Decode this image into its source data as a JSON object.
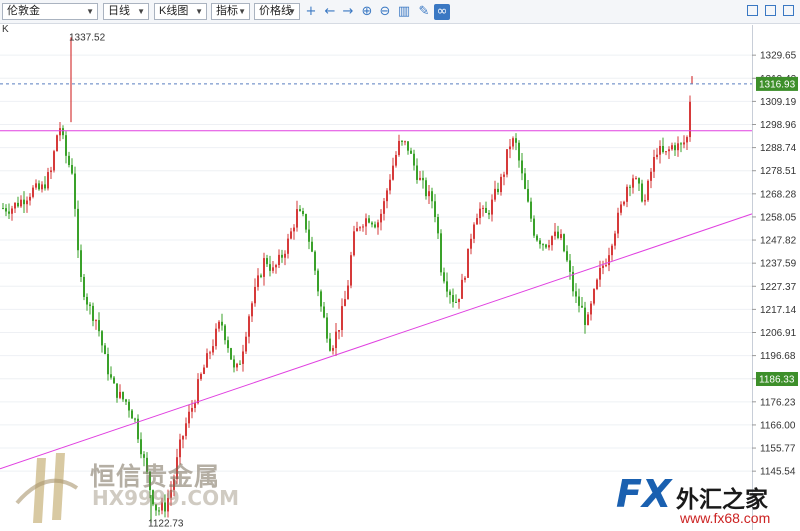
{
  "toolbar": {
    "symbol": "伦敦金",
    "period": "日线",
    "chart_type": "K线图",
    "indicator": "指标",
    "price_line": "价格线",
    "icons": [
      "crosshair-icon",
      "arrow-left-icon",
      "arrow-right-icon",
      "zoom-in-icon",
      "zoom-out-icon",
      "bar-chart-icon",
      "pencil-icon",
      "link-icon"
    ],
    "window_icons": [
      "restore-icon",
      "maximize-icon",
      "fullscreen-icon"
    ]
  },
  "chart_label": "K",
  "chart_data": {
    "type": "candlestick",
    "y_ticks": [
      1329.65,
      1319.42,
      1309.19,
      1298.96,
      1288.74,
      1278.51,
      1268.28,
      1258.05,
      1247.82,
      1237.59,
      1227.37,
      1217.14,
      1206.91,
      1196.68,
      1186.45,
      1176.23,
      1166.0,
      1155.77,
      1145.54
    ],
    "ylim": [
      1119.5,
      1343.0
    ],
    "annotations": {
      "high_label": "1337.52",
      "low_label": "1122.73"
    },
    "price_tags": [
      {
        "value": 1316.93,
        "text": "1316.93",
        "color": "#3d8f2a"
      },
      {
        "value": 1186.33,
        "text": "1186.33",
        "color": "#3d8f2a"
      }
    ],
    "horizontal_lines": [
      {
        "value": 1316.93,
        "style": "dashed",
        "color": "#5a7fc0"
      },
      {
        "value": 1296.2,
        "style": "solid",
        "color": "#e040e0"
      }
    ],
    "trend_lines": [
      {
        "from": [
          0,
          1146.6
        ],
        "to": [
          752,
          1259.4
        ],
        "color": "#e040e0"
      }
    ],
    "colors": {
      "up": "#d63a3a",
      "down": "#3aa12a"
    },
    "grid": true,
    "watermarks": {
      "left_cn": "恒信贵金属",
      "left_en": "HX9999.COM",
      "right_fx": "FX",
      "right_cn": "外汇之家",
      "right_url": "www.fx68.com"
    }
  }
}
